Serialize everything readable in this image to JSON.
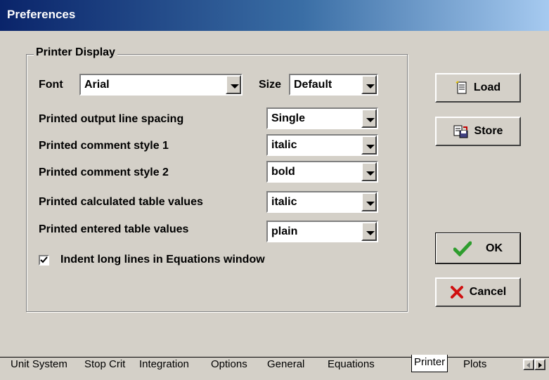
{
  "window": {
    "title": "Preferences"
  },
  "group": {
    "legend": "Printer Display"
  },
  "font_row": {
    "font_label": "Font",
    "font_value": "Arial",
    "size_label": "Size",
    "size_value": "Default"
  },
  "rows": [
    {
      "label": "Printed output line spacing",
      "value": "Single"
    },
    {
      "label": "Printed comment style 1",
      "value": "italic"
    },
    {
      "label": "Printed comment style 2",
      "value": "bold"
    },
    {
      "label": "Printed calculated table values",
      "value": "italic"
    },
    {
      "label": "Printed entered table values",
      "value": "plain"
    }
  ],
  "indent_checkbox": {
    "label": "Indent long lines in Equations window",
    "checked": true
  },
  "buttons": {
    "load": "Load",
    "store": "Store",
    "ok": "OK",
    "cancel": "Cancel"
  },
  "tabs": [
    "Unit System",
    "Stop Crit",
    "Integration",
    "Options",
    "General",
    "Equations",
    "Printer",
    "Plots"
  ],
  "active_tab": "Printer",
  "colors": {
    "title_start": "#0a246a",
    "title_end": "#a6caf0",
    "ok_check": "#2e9d2e",
    "cancel_x": "#d01010"
  }
}
